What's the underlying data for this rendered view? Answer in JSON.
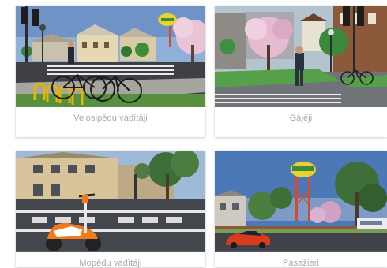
{
  "cards": [
    {
      "label": "Velosipēdu vadītāji",
      "image": "cyclists-bicycles-rack-street-scene"
    },
    {
      "label": "Gājēji",
      "image": "pedestrian-crosswalk-street-scene"
    },
    {
      "label": "Mopēdu vadītāji",
      "image": "orange-moped-street-scene"
    },
    {
      "label": "Pasažieri",
      "image": "red-car-water-tower-street-scene"
    }
  ]
}
